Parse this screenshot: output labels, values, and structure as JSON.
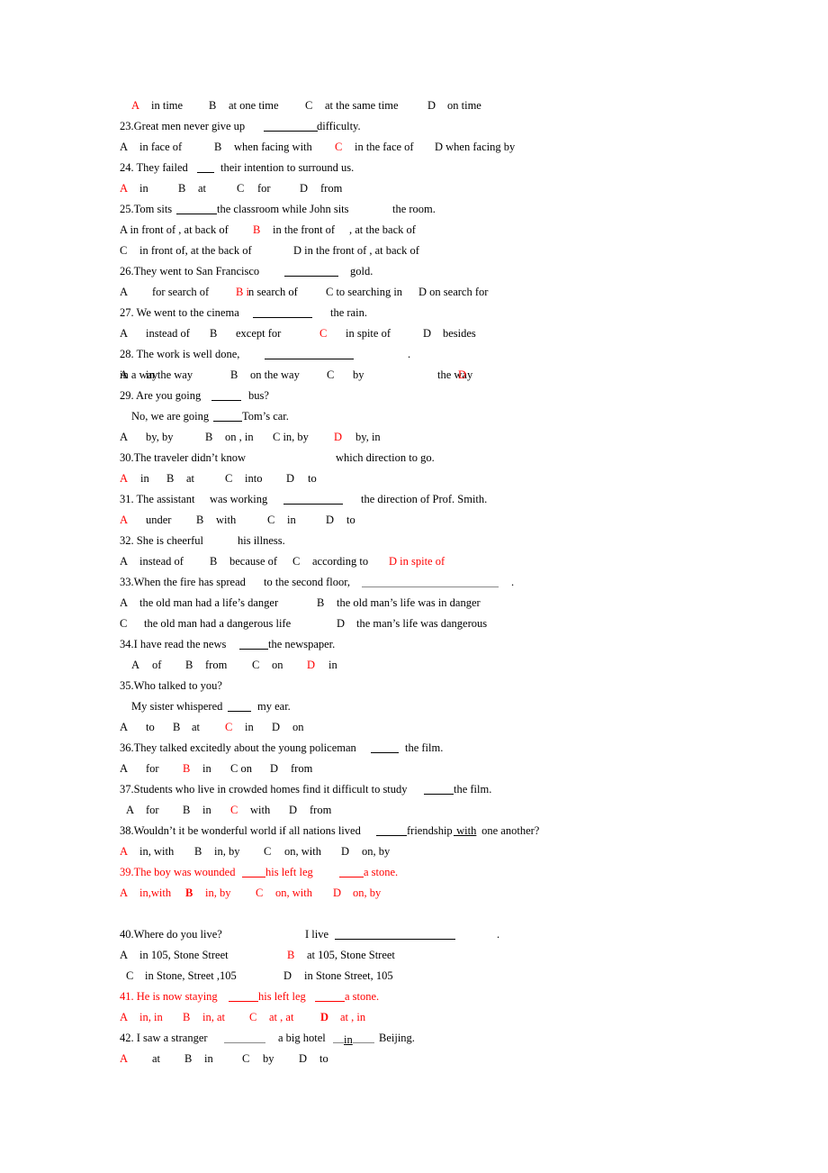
{
  "document": {
    "red_color": "#ff0000",
    "lines": [
      {
        "name": "q22-options",
        "segs": [
          {
            "t": "A",
            "c": "red"
          },
          {
            "t": "in time"
          },
          {
            "t": "B"
          },
          {
            "t": "at one time"
          },
          {
            "t": "C"
          },
          {
            "t": "at the same time"
          },
          {
            "t": "D"
          },
          {
            "t": "on time"
          }
        ]
      },
      {
        "name": "q23-question",
        "segs": [
          {
            "t": "23.Great men never give up"
          },
          {
            "t": "",
            "blank": true
          },
          {
            "t": "difficulty."
          }
        ]
      },
      {
        "name": "q23-options",
        "segs": [
          {
            "t": "A"
          },
          {
            "t": "in face of"
          },
          {
            "t": "B"
          },
          {
            "t": "when facing with"
          },
          {
            "t": "C",
            "c": "red"
          },
          {
            "t": "in the face of"
          },
          {
            "t": "D when facing by"
          }
        ]
      },
      {
        "name": "q24-question",
        "segs": [
          {
            "t": "24. They failed"
          },
          {
            "t": "",
            "blank": true
          },
          {
            "t": "their intention to surround us."
          }
        ]
      },
      {
        "name": "q24-options",
        "segs": [
          {
            "t": "A",
            "c": "red"
          },
          {
            "t": "in"
          },
          {
            "t": "B"
          },
          {
            "t": "at"
          },
          {
            "t": "C"
          },
          {
            "t": "for"
          },
          {
            "t": "D"
          },
          {
            "t": "from"
          }
        ]
      },
      {
        "name": "q25-question",
        "segs": [
          {
            "t": "25.Tom sits"
          },
          {
            "t": "",
            "blank": true
          },
          {
            "t": "the classroom while John sits"
          },
          {
            "t": "the room."
          }
        ]
      },
      {
        "name": "q25-options-ab",
        "segs": [
          {
            "t": "A in front of , at back of"
          },
          {
            "t": "B",
            "c": "red"
          },
          {
            "t": "in the front of"
          },
          {
            "t": ", at the back of"
          }
        ]
      },
      {
        "name": "q25-options-cd",
        "segs": [
          {
            "t": "C"
          },
          {
            "t": "in front of, at the back of"
          },
          {
            "t": "D in the front of , at back of"
          }
        ]
      },
      {
        "name": "q26-question",
        "segs": [
          {
            "t": "26.They went to San Francisco"
          },
          {
            "t": "",
            "blank": true
          },
          {
            "t": "gold."
          }
        ]
      },
      {
        "name": "q26-options",
        "segs": [
          {
            "t": "A"
          },
          {
            "t": "for search of"
          },
          {
            "t": "B i",
            "c": "red"
          },
          {
            "t": "n search of"
          },
          {
            "t": "C to searching in"
          },
          {
            "t": "D on search for"
          }
        ]
      },
      {
        "name": "q27-question",
        "segs": [
          {
            "t": "27. We went to the cinema"
          },
          {
            "t": "",
            "blank": true
          },
          {
            "t": "the rain."
          }
        ]
      },
      {
        "name": "q27-options",
        "segs": [
          {
            "t": "A"
          },
          {
            "t": "instead of"
          },
          {
            "t": "B"
          },
          {
            "t": "except for"
          },
          {
            "t": "C",
            "c": "red"
          },
          {
            "t": "in spite of"
          },
          {
            "t": "D"
          },
          {
            "t": "besides"
          }
        ]
      },
      {
        "name": "q28-question",
        "segs": [
          {
            "t": "28. The work is well done,"
          },
          {
            "t": "",
            "blank": true
          },
          {
            "t": "."
          }
        ]
      },
      {
        "name": "q28-options",
        "segs": [
          {
            "t": "A"
          },
          {
            "t": "in the way"
          },
          {
            "t": "B"
          },
          {
            "t": "on the way"
          },
          {
            "t": "C"
          },
          {
            "t": "by"
          },
          {
            "t": "the way"
          },
          {
            "t": "D",
            "c": "red"
          },
          {
            "t": "in a way"
          }
        ]
      },
      {
        "name": "q29-question",
        "segs": [
          {
            "t": "29. Are you going"
          },
          {
            "t": "",
            "blank": true
          },
          {
            "t": "bus?"
          }
        ]
      },
      {
        "name": "q29-answer-line",
        "segs": [
          {
            "t": "No, we are going"
          },
          {
            "t": "",
            "blank": true
          },
          {
            "t": "Tom’s car."
          }
        ]
      },
      {
        "name": "q29-options",
        "segs": [
          {
            "t": "A"
          },
          {
            "t": "by, by"
          },
          {
            "t": "B"
          },
          {
            "t": "on , in"
          },
          {
            "t": "C in, by"
          },
          {
            "t": "D",
            "c": "red"
          },
          {
            "t": "by, in"
          }
        ]
      },
      {
        "name": "q30-question",
        "segs": [
          {
            "t": "30.The traveler didn’t know"
          },
          {
            "t": "which direction to go."
          }
        ]
      },
      {
        "name": "q30-options",
        "segs": [
          {
            "t": "A",
            "c": "red"
          },
          {
            "t": "in"
          },
          {
            "t": "B"
          },
          {
            "t": "at"
          },
          {
            "t": "C"
          },
          {
            "t": "into"
          },
          {
            "t": "D"
          },
          {
            "t": "to"
          }
        ]
      },
      {
        "name": "q31-question",
        "segs": [
          {
            "t": "31. The assistant"
          },
          {
            "t": "was working"
          },
          {
            "t": "",
            "blank": true
          },
          {
            "t": "the direction of Prof. Smith."
          }
        ]
      },
      {
        "name": "q31-options",
        "segs": [
          {
            "t": "A",
            "c": "red"
          },
          {
            "t": "under"
          },
          {
            "t": "B"
          },
          {
            "t": "with"
          },
          {
            "t": "C"
          },
          {
            "t": "in"
          },
          {
            "t": "D"
          },
          {
            "t": "to"
          }
        ]
      },
      {
        "name": "q32-question",
        "segs": [
          {
            "t": "32. She is cheerful"
          },
          {
            "t": "his illness."
          }
        ]
      },
      {
        "name": "q32-options",
        "segs": [
          {
            "t": "A"
          },
          {
            "t": "instead of"
          },
          {
            "t": "B"
          },
          {
            "t": "because of"
          },
          {
            "t": "C"
          },
          {
            "t": "according to"
          },
          {
            "t": "D in spite of",
            "c": "red"
          }
        ]
      },
      {
        "name": "q33-question",
        "segs": [
          {
            "t": "33.When the fire has spread"
          },
          {
            "t": "to the second floor,"
          },
          {
            "t": "",
            "blank": true,
            "gray": true
          },
          {
            "t": "."
          }
        ]
      },
      {
        "name": "q33-options-ab",
        "segs": [
          {
            "t": "A"
          },
          {
            "t": "the old man had a life’s danger"
          },
          {
            "t": "B"
          },
          {
            "t": "the old man’s life was in danger"
          }
        ]
      },
      {
        "name": "q33-options-cd",
        "segs": [
          {
            "t": "C"
          },
          {
            "t": "the old man had a dangerous life"
          },
          {
            "t": "D"
          },
          {
            "t": "the man’s life was dangerous"
          }
        ]
      },
      {
        "name": "q34-question",
        "segs": [
          {
            "t": "34.I have read the news"
          },
          {
            "t": "",
            "blank": true
          },
          {
            "t": "the newspaper."
          }
        ]
      },
      {
        "name": "q34-options",
        "segs": [
          {
            "t": "A"
          },
          {
            "t": "of"
          },
          {
            "t": "B"
          },
          {
            "t": "from"
          },
          {
            "t": "C"
          },
          {
            "t": "on"
          },
          {
            "t": "D",
            "c": "red"
          },
          {
            "t": "in"
          }
        ]
      },
      {
        "name": "q35-question",
        "segs": [
          {
            "t": "35.Who talked to you?"
          }
        ]
      },
      {
        "name": "q35-answer-line",
        "segs": [
          {
            "t": "My sister whispered"
          },
          {
            "t": "",
            "blank": true
          },
          {
            "t": "my ear."
          }
        ]
      },
      {
        "name": "q35-options",
        "segs": [
          {
            "t": "A"
          },
          {
            "t": "to"
          },
          {
            "t": "B"
          },
          {
            "t": "at"
          },
          {
            "t": "C",
            "c": "red"
          },
          {
            "t": "in"
          },
          {
            "t": "D"
          },
          {
            "t": "on"
          }
        ]
      },
      {
        "name": "q36-question",
        "segs": [
          {
            "t": "36.They talked excitedly about the young policeman"
          },
          {
            "t": "",
            "blank": true
          },
          {
            "t": "the film."
          }
        ]
      },
      {
        "name": "q36-options",
        "segs": [
          {
            "t": "A"
          },
          {
            "t": "for"
          },
          {
            "t": "B",
            "c": "red"
          },
          {
            "t": "in"
          },
          {
            "t": "C on"
          },
          {
            "t": "D"
          },
          {
            "t": "from"
          }
        ]
      },
      {
        "name": "q37-question",
        "segs": [
          {
            "t": "37.Students who live in crowded homes find it difficult to study"
          },
          {
            "t": "",
            "blank": true
          },
          {
            "t": "the film."
          }
        ]
      },
      {
        "name": "q37-options",
        "segs": [
          {
            "t": "A"
          },
          {
            "t": "for"
          },
          {
            "t": "B"
          },
          {
            "t": "in"
          },
          {
            "t": "C",
            "c": "red"
          },
          {
            "t": "with"
          },
          {
            "t": "D"
          },
          {
            "t": "from"
          }
        ]
      },
      {
        "name": "q38-question",
        "segs": [
          {
            "t": "38.Wouldn’t it be wonderful world if all nations lived"
          },
          {
            "t": "",
            "blank": true
          },
          {
            "t": "friendship"
          },
          {
            "t": " with",
            "u": true
          },
          {
            "t": " one another?"
          }
        ]
      },
      {
        "name": "q38-options",
        "segs": [
          {
            "t": "A",
            "c": "red"
          },
          {
            "t": "in, with"
          },
          {
            "t": "B"
          },
          {
            "t": "in, by"
          },
          {
            "t": "C"
          },
          {
            "t": "on, with"
          },
          {
            "t": "D"
          },
          {
            "t": "on, by"
          }
        ]
      },
      {
        "name": "q39-question",
        "segs": [
          {
            "t": "39.The boy was wounded",
            "c": "red"
          },
          {
            "t": "",
            "blank": true,
            "c": "red"
          },
          {
            "t": "his left leg",
            "c": "red"
          },
          {
            "t": "",
            "blank": true,
            "c": "red"
          },
          {
            "t": "a stone.",
            "c": "red"
          }
        ]
      },
      {
        "name": "q39-options",
        "segs": [
          {
            "t": "A",
            "c": "red"
          },
          {
            "t": "in,with",
            "c": "red"
          },
          {
            "t": "B",
            "c": "red",
            "b": true
          },
          {
            "t": "in, by",
            "c": "red"
          },
          {
            "t": "C",
            "c": "red"
          },
          {
            "t": "on, with",
            "c": "red"
          },
          {
            "t": "D",
            "c": "red"
          },
          {
            "t": "on, by",
            "c": "red"
          }
        ]
      },
      {
        "name": "q40-question",
        "segs": [
          {
            "t": "40.Where do you live?"
          },
          {
            "t": "I live"
          },
          {
            "t": "",
            "blank": true
          },
          {
            "t": "."
          }
        ]
      },
      {
        "name": "q40-options-ab",
        "segs": [
          {
            "t": "A"
          },
          {
            "t": "in 105, Stone Street"
          },
          {
            "t": "B",
            "c": "red"
          },
          {
            "t": "at 105, Stone Street"
          }
        ]
      },
      {
        "name": "q40-options-cd",
        "segs": [
          {
            "t": "C"
          },
          {
            "t": "in Stone, Street ,105"
          },
          {
            "t": "D"
          },
          {
            "t": "in Stone Street, 105"
          }
        ]
      },
      {
        "name": "q41-question",
        "segs": [
          {
            "t": "41. He is now staying",
            "c": "red"
          },
          {
            "t": "",
            "blank": true,
            "c": "red"
          },
          {
            "t": "his left leg",
            "c": "red"
          },
          {
            "t": "",
            "blank": true,
            "c": "red"
          },
          {
            "t": "a stone.",
            "c": "red"
          }
        ]
      },
      {
        "name": "q41-options",
        "segs": [
          {
            "t": "A",
            "c": "red"
          },
          {
            "t": "in, in",
            "c": "red"
          },
          {
            "t": "B",
            "c": "red"
          },
          {
            "t": "in, at",
            "c": "red"
          },
          {
            "t": "C",
            "c": "red"
          },
          {
            "t": "at , at",
            "c": "red"
          },
          {
            "t": "D",
            "c": "red",
            "b": true
          },
          {
            "t": "at , in",
            "c": "red"
          }
        ]
      },
      {
        "name": "q42-question",
        "segs": [
          {
            "t": "42. I saw a stranger"
          },
          {
            "t": "",
            "blank": true,
            "gray": true
          },
          {
            "t": "a big hotel"
          },
          {
            "t": "in",
            "fill_blank": true
          },
          {
            "t": "Beijing."
          }
        ]
      },
      {
        "name": "q42-options",
        "segs": [
          {
            "t": "A",
            "c": "red"
          },
          {
            "t": "at"
          },
          {
            "t": "B"
          },
          {
            "t": "in"
          },
          {
            "t": "C"
          },
          {
            "t": "by"
          },
          {
            "t": "D"
          },
          {
            "t": "to"
          }
        ]
      }
    ]
  }
}
